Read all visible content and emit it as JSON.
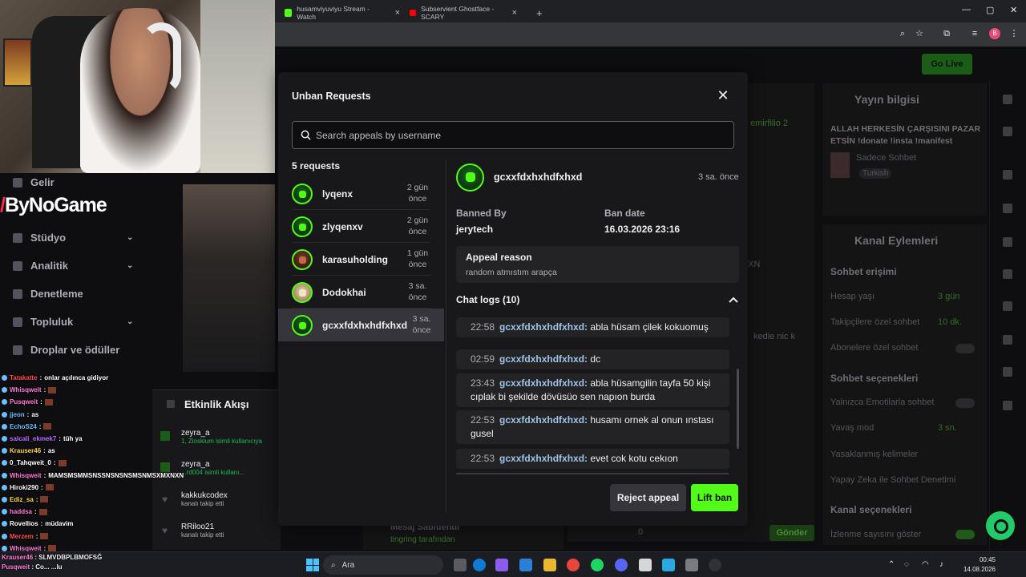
{
  "browser": {
    "tabs": [
      {
        "title": "husamviyuviyu Stream - Watch"
      },
      {
        "title": "Subservient Ghostface - SCARY"
      }
    ]
  },
  "dashboard": {
    "go_live": "Go Live",
    "stream_info_title": "Yayın bilgisi",
    "stream_title": "ALLAH HERKESİN ÇARŞISINI PAZAR ETSİN !donate !insta !manifest",
    "category": "Sadece Sohbet",
    "language": "Turkish",
    "channel_actions_title": "Kanal Eylemleri",
    "chat_access": "Sohbet erişimi",
    "account_age": "Hesap yaşı",
    "account_age_val": "3 gün",
    "followers_only": "Takipçilere özel sohbet",
    "followers_only_val": "10 dk.",
    "subs_only": "Abonelere özel sohbet",
    "chat_options": "Sohbet seçenekleri",
    "emote_only": "Yalnızca Emotilarla sohbet",
    "slow_mode": "Yavaş mod",
    "slow_mode_val": "3 sn.",
    "banned_words": "Yasaklanmış kelimeler",
    "ai_mod": "Yapay Zeka ile Sohbet Denetimi",
    "channel_options": "Kanal seçenekleri",
    "view_count": "İzlenme sayısını göster",
    "send": "Gönder",
    "pinned": "Mesaj Sabitlendi",
    "pinned_by": "tingring tarafından"
  },
  "left_nav": {
    "items": [
      {
        "label": "Gelir"
      },
      {
        "label": "Stüdyo"
      },
      {
        "label": "Analitik"
      },
      {
        "label": "Denetleme"
      },
      {
        "label": "Topluluk"
      },
      {
        "label": "Droplar ve ödüller"
      }
    ],
    "brand": "ByNoGame"
  },
  "activity": {
    "title": "Etkinlik Akışı",
    "items": [
      {
        "name": "zeyra_a",
        "sub": "1, Zioskium isimli kullanıcıya"
      },
      {
        "name": "zeyra_a",
        "sub": "...rd004 isimli kullanı..."
      },
      {
        "name": "kakkukcodex",
        "sub": "kanalı takip etti"
      },
      {
        "name": "RRiloo21",
        "sub": "kanalı takip etti"
      }
    ]
  },
  "overlay_chat": [
    {
      "user": "Tatakatte",
      "msg": "onlar açılınca gidiyor",
      "color": "#ff4d4d"
    },
    {
      "user": "Whisqweit",
      "msg": "",
      "color": "#ff7ad9"
    },
    {
      "user": "Pusqweit",
      "msg": "",
      "color": "#ff7ad9"
    },
    {
      "user": "jjeon",
      "msg": "as",
      "color": "#6bc0ff"
    },
    {
      "user": "EchoS24",
      "msg": "",
      "color": "#6bc0ff"
    },
    {
      "user": "salcali_ekmek7",
      "msg": "tüh ya",
      "color": "#c06bff"
    },
    {
      "user": "Krauser46",
      "msg": "as",
      "color": "#ffd84d"
    },
    {
      "user": "0_Tahqweit_0",
      "msg": "",
      "color": "#ffffff"
    },
    {
      "user": "Whisqweit",
      "msg": "MAMSMSMMSNSSNSNSNSMSNMSXMXNXN",
      "color": "#ff7ad9"
    },
    {
      "user": "Hiroki290",
      "msg": "",
      "color": "#ffffff"
    },
    {
      "user": "Ediz_sa",
      "msg": "",
      "color": "#ffd84d"
    },
    {
      "user": "haddsa",
      "msg": "",
      "color": "#ff7ad9"
    },
    {
      "user": "Rovellios",
      "msg": "müdavim",
      "color": "#ffffff"
    },
    {
      "user": "Merzem",
      "msg": "",
      "color": "#ff4d4d"
    },
    {
      "user": "Whisqweit",
      "msg": "",
      "color": "#ff7ad9"
    }
  ],
  "bottom_ticker": [
    {
      "user": "Krauser46",
      "msg": "SLMVDBPLBMOFSĞ"
    },
    {
      "user": "Pusqweit",
      "msg": "Co... ...lu"
    }
  ],
  "modal": {
    "title": "Unban Requests",
    "search_placeholder": "Search appeals by username",
    "count_label": "5 requests",
    "requests": [
      {
        "name": "lyqenx",
        "time": "2 gün önce",
        "avatar": "green"
      },
      {
        "name": "zlyqenxv",
        "time": "2 gün önce",
        "avatar": "green"
      },
      {
        "name": "karasuholding",
        "time": "1 gün önce",
        "avatar": "brown"
      },
      {
        "name": "Dodokhai",
        "time": "3 sa. önce",
        "avatar": "beige"
      },
      {
        "name": "gcxxfdxhxhdfxhxd",
        "time": "3 sa. önce",
        "avatar": "green",
        "selected": true
      }
    ],
    "detail": {
      "username": "gcxxfdxhxhdfxhxd",
      "time": "3 sa. önce",
      "banned_by_label": "Banned By",
      "banned_by": "jerytech",
      "ban_date_label": "Ban date",
      "ban_date": "16.03.2026 23:16",
      "appeal_reason_label": "Appeal reason",
      "appeal_reason": "random atmıstım arapça",
      "chat_logs_label": "Chat logs (10)",
      "logs": [
        {
          "time": "22:58",
          "user": "gcxxfdxhxhdfxhxd:",
          "text": "abla hüsam çilek kokuomuş"
        },
        {
          "time": "02:59",
          "user": "gcxxfdxhxhdfxhxd:",
          "text": "dc"
        },
        {
          "time": "23:43",
          "user": "gcxxfdxhxhdfxhxd:",
          "text": "abla hüsamgilin tayfa 50 kişi cıplak bi şekilde dövüsüo sen napıon burda"
        },
        {
          "time": "22:53",
          "user": "gcxxfdxhxhdfxhxd:",
          "text": "husamı ornek al onun ınstası gusel"
        },
        {
          "time": "22:53",
          "user": "gcxxfdxhxhdfxhxd:",
          "text": "evet cok kotu cekıon"
        }
      ]
    },
    "reject_label": "Reject appeal",
    "lift_label": "Lift ban"
  },
  "taskbar": {
    "search_placeholder": "Ara",
    "time": "00:45",
    "date": "14.08.2026"
  },
  "colors": {
    "accent": "#53fc18",
    "modal_bg": "#18181b",
    "page_bg": "#0e0e10"
  }
}
